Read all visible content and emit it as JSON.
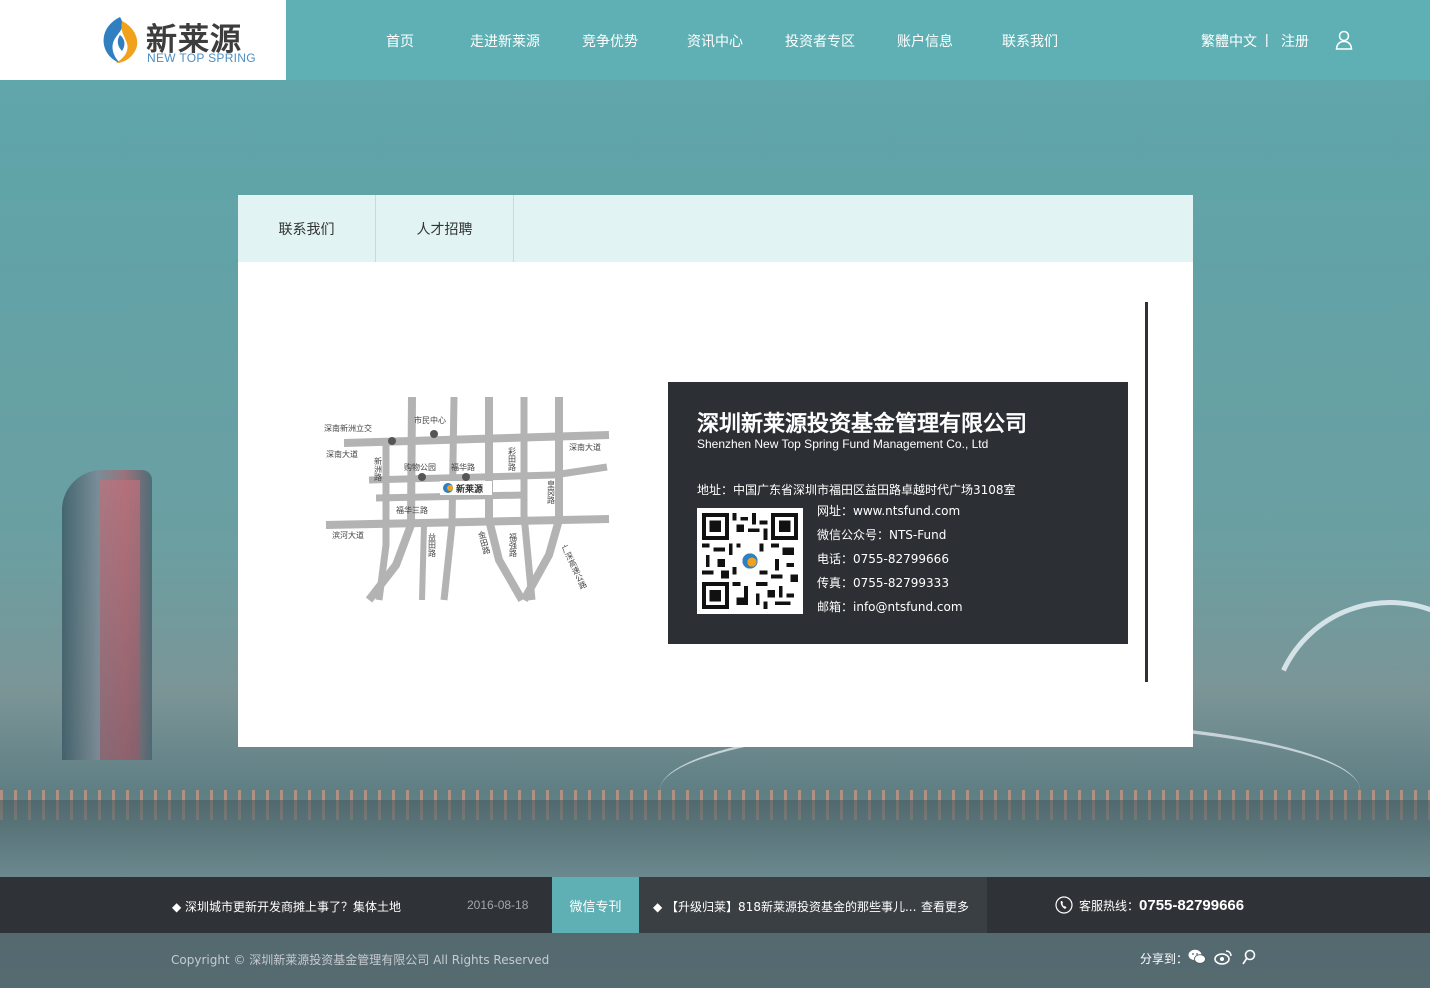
{
  "brand": {
    "name_cn": "新莱源",
    "name_en": "NEW TOP SPRING"
  },
  "nav": {
    "items": [
      {
        "label": "首页"
      },
      {
        "label": "走进新莱源"
      },
      {
        "label": "竞争优势"
      },
      {
        "label": "资讯中心"
      },
      {
        "label": "投资者专区"
      },
      {
        "label": "账户信息"
      },
      {
        "label": "联系我们"
      }
    ],
    "lang": "繁體中文",
    "divider": "|",
    "register": "注册"
  },
  "tabs": [
    {
      "label": "联系我们"
    },
    {
      "label": "人才招聘"
    }
  ],
  "map": {
    "labels": {
      "civic_center": "市民中心",
      "shennan_xinzhou": "深南新洲立交",
      "shennan_west": "深南大道",
      "shennan_east": "深南大道",
      "xinzhou_road": "新洲路",
      "caitian_road": "彩田路",
      "huanggang_road": "皇岗路",
      "shopping_park": "购物公园",
      "fuhua_road": "福华路",
      "fuhua_3rd": "福华三路",
      "binhe": "滨河大道",
      "yitian": "益田路",
      "jintian": "金田路",
      "fuqiang": "福强路",
      "guangshen": "广深高速公路",
      "logo": "新莱源"
    }
  },
  "company": {
    "name_cn": "深圳新莱源投资基金管理有限公司",
    "name_en": "Shenzhen New Top Spring Fund Management Co., Ltd",
    "address": "地址：中国广东省深圳市福田区益田路卓越时代广场3108室",
    "website": "网址：www.ntsfund.com",
    "wechat": "微信公众号：NTS-Fund",
    "phone": "电话：0755-82799666",
    "fax": "传真：0755-82799333",
    "email": "邮箱：info@ntsfund.com"
  },
  "footer": {
    "news_item": "◆  深圳城市更新开发商摊上事了？集体土地",
    "news_date": "2016-08-18",
    "wechat_tab": "微信专刊",
    "wechat_item": "◆  【升级归莱】818新莱源投资基金的那些事儿...",
    "more": "查看更多",
    "hotline_label": "客服热线：",
    "hotline_number": "0755-82799666",
    "copyright": "Copyright © 深圳新莱源投资基金管理有限公司 All Rights Reserved",
    "share_label": "分享到："
  },
  "colors": {
    "header_bg": "#5fb0b4",
    "tab_bg": "#e1f3f2",
    "card_bg": "#2c2f33",
    "footer_bg": "#2f3236",
    "accent": "#5fb0b4"
  }
}
